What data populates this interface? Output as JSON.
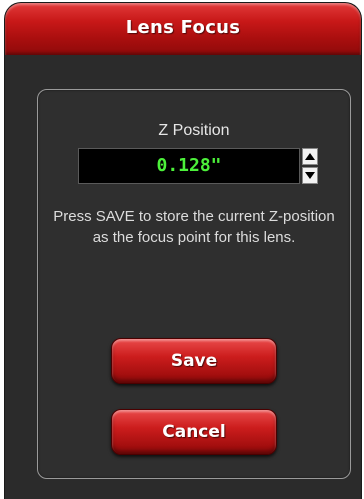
{
  "window": {
    "title": "Lens Focus"
  },
  "z_position": {
    "label": "Z Position",
    "value": "0.128\""
  },
  "stepper": {
    "up_icon": "arrow-up-icon",
    "down_icon": "arrow-down-icon"
  },
  "help_text": "Press SAVE to store the current Z-position as the focus point for this lens.",
  "buttons": {
    "save_label": "Save",
    "cancel_label": "Cancel"
  },
  "colors": {
    "accent_red": "#c81818",
    "value_green": "#4cf03a",
    "background": "#2b2b2b"
  }
}
